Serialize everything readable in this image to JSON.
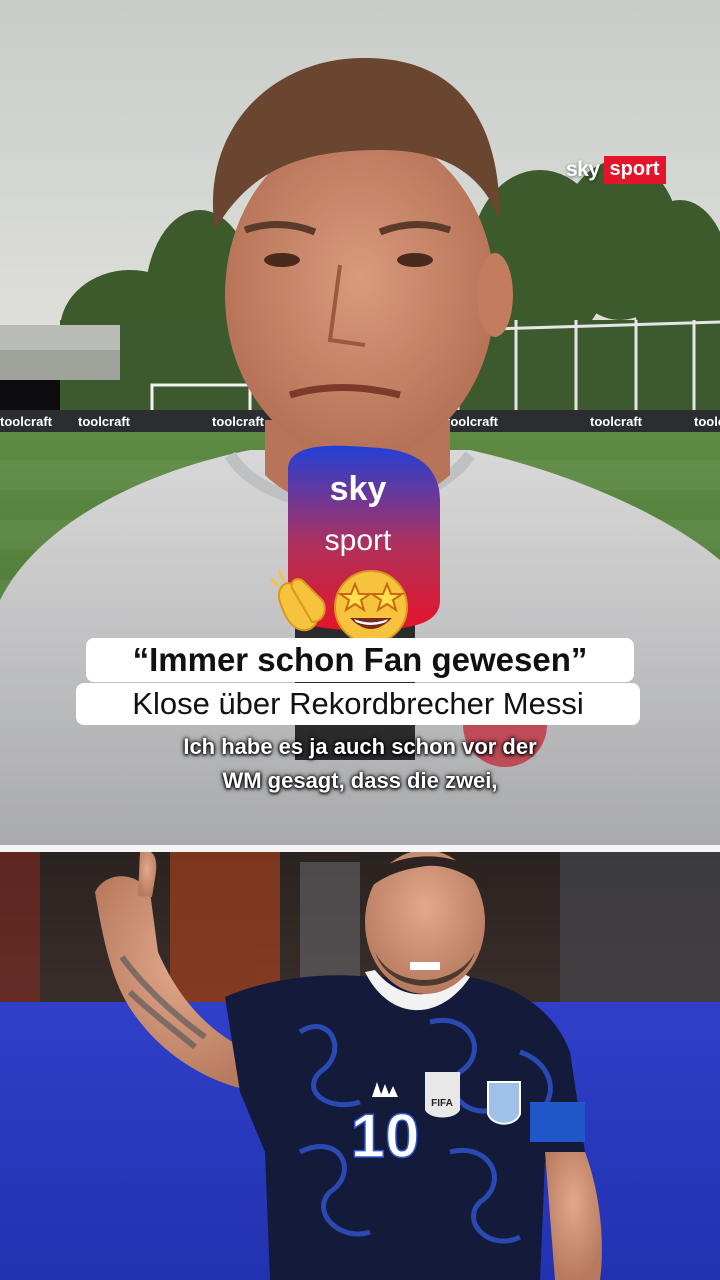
{
  "top_clip": {
    "sky_logo": {
      "sky": "sky",
      "sport": "sport"
    },
    "mic_flag": {
      "sky": "sky",
      "sport": "sport"
    },
    "ad_boards": [
      "toolcraft",
      "toolcraft",
      "toolcraft",
      "toolcraft",
      "toolcraft",
      "toolcraft",
      "tool"
    ],
    "emojis": [
      "clapping-hands-icon",
      "star-struck-face-icon"
    ]
  },
  "headline": {
    "line1": "“Immer schon Fan gewesen”",
    "line2": "Klose über Rekordbrecher Messi"
  },
  "subtitles": {
    "line1": "Ich habe es ja auch schon vor der",
    "line2": "WM gesagt, dass die zwei,"
  },
  "bottom_clip": {
    "jersey_number": "10",
    "badge_text": "FIFA"
  },
  "colors": {
    "sky_red": "#e4142a",
    "sky_blue": "#1f3fd8",
    "pitch_green": "#4e7d3a",
    "jersey_navy": "#141a3a"
  }
}
